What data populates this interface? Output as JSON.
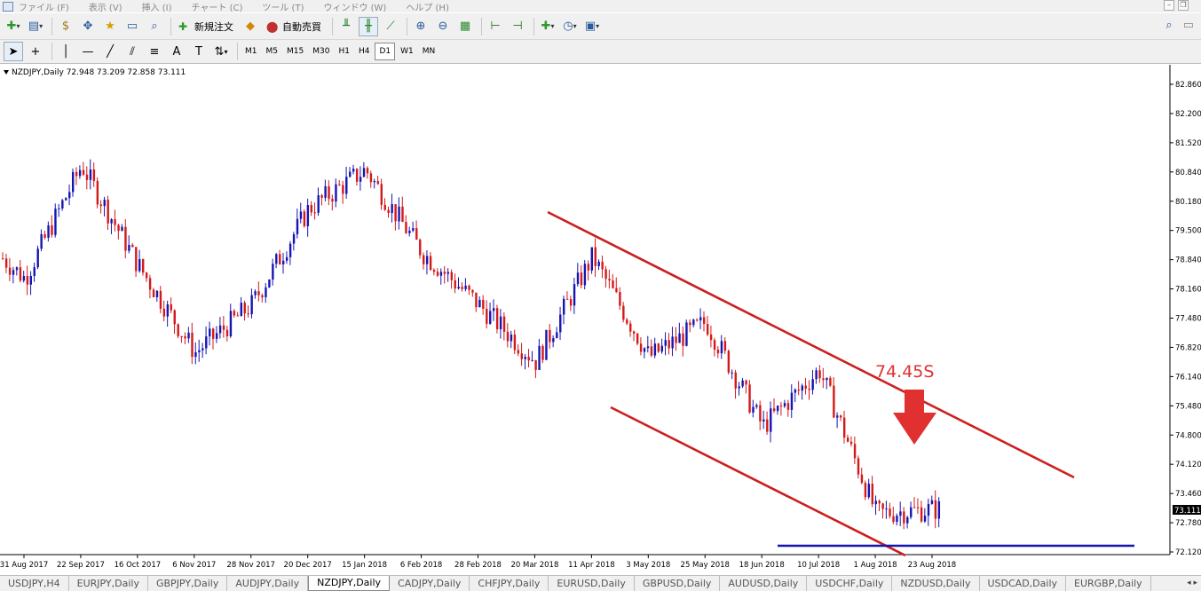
{
  "menubar": {
    "items": [
      "ファイル (F)",
      "表示 (V)",
      "挿入 (I)",
      "チャート (C)",
      "ツール (T)",
      "ウィンドウ (W)",
      "ヘルプ (H)"
    ]
  },
  "toolbar": {
    "new_order_label": "新規注文",
    "auto_trade_label": "自動売買",
    "timeframes": [
      "M1",
      "M5",
      "M15",
      "M30",
      "H1",
      "H4",
      "D1",
      "W1",
      "MN"
    ],
    "active_timeframe": "D1"
  },
  "chart": {
    "header": "NZDJPY,Daily  72.948 73.209 72.858 73.111",
    "annotation_text": "74.45S",
    "current_price_label": "73.111",
    "price_ticks": [
      "82.860",
      "82.200",
      "81.520",
      "80.840",
      "80.180",
      "79.500",
      "78.840",
      "78.160",
      "77.480",
      "76.820",
      "76.140",
      "75.480",
      "74.800",
      "74.120",
      "73.460",
      "72.780",
      "72.120"
    ],
    "date_ticks": [
      "31 Aug 2017",
      "22 Sep 2017",
      "16 Oct 2017",
      "6 Nov 2017",
      "28 Nov 2017",
      "20 Dec 2017",
      "15 Jan 2018",
      "6 Feb 2018",
      "28 Feb 2018",
      "20 Mar 2018",
      "11 Apr 2018",
      "3 May 2018",
      "25 May 2018",
      "18 Jun 2018",
      "10 Jul 2018",
      "1 Aug 2018",
      "23 Aug 2018"
    ],
    "colors": {
      "bull": "#1515b4",
      "bear": "#d41919",
      "trendline": "#cc1f1f",
      "support": "#1414b0",
      "annotation": "#e03030"
    }
  },
  "chart_data": {
    "type": "candlestick",
    "symbol": "NZDJPY",
    "timeframe": "Daily",
    "ylim": [
      72.12,
      82.86
    ],
    "ohlc_last": {
      "open": 72.948,
      "high": 73.209,
      "low": 72.858,
      "close": 73.111
    },
    "key_closes": [
      {
        "date": "31 Aug 2017",
        "price": 78.4
      },
      {
        "date": "22 Sep 2017",
        "price": 81.0
      },
      {
        "date": "16 Oct 2017",
        "price": 78.7
      },
      {
        "date": "6 Nov 2017",
        "price": 76.7
      },
      {
        "date": "28 Nov 2017",
        "price": 77.8
      },
      {
        "date": "20 Dec 2017",
        "price": 80.0
      },
      {
        "date": "15 Jan 2018",
        "price": 80.9
      },
      {
        "date": "6 Feb 2018",
        "price": 79.0
      },
      {
        "date": "28 Feb 2018",
        "price": 77.8
      },
      {
        "date": "20 Mar 2018",
        "price": 76.5
      },
      {
        "date": "11 Apr 2018",
        "price": 78.9
      },
      {
        "date": "3 May 2018",
        "price": 76.6
      },
      {
        "date": "25 May 2018",
        "price": 77.4
      },
      {
        "date": "18 Jun 2018",
        "price": 75.0
      },
      {
        "date": "10 Jul 2018",
        "price": 76.3
      },
      {
        "date": "1 Aug 2018",
        "price": 73.0
      },
      {
        "date": "23 Aug 2018",
        "price": 73.1
      }
    ],
    "annotations": [
      {
        "type": "level",
        "label": "74.45S",
        "price": 74.45
      }
    ]
  },
  "tabs": {
    "items": [
      "USDJPY,H4",
      "EURJPY,Daily",
      "GBPJPY,Daily",
      "AUDJPY,Daily",
      "NZDJPY,Daily",
      "CADJPY,Daily",
      "CHFJPY,Daily",
      "EURUSD,Daily",
      "GBPUSD,Daily",
      "AUDUSD,Daily",
      "USDCHF,Daily",
      "NZDUSD,Daily",
      "USDCAD,Daily",
      "EURGBP,Daily"
    ],
    "active": "NZDJPY,Daily"
  }
}
